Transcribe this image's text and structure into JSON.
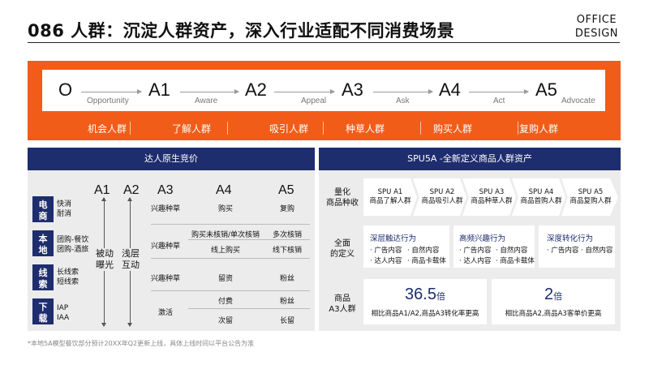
{
  "header": {
    "title": "086 人群：沉淀人群资产，深入行业适配不同消费场景",
    "brand_line1": "OFFICE",
    "brand_line2": "DESIGN"
  },
  "funnel": {
    "stages": [
      {
        "code": "O",
        "name": "Opportunity"
      },
      {
        "code": "A1",
        "name": "Aware"
      },
      {
        "code": "A2",
        "name": "Appeal"
      },
      {
        "code": "A3",
        "name": "Ask"
      },
      {
        "code": "A4",
        "name": "Act"
      },
      {
        "code": "A5",
        "name": "Advocate"
      }
    ],
    "groups": [
      "机会人群",
      "了解人群",
      "吸引人群",
      "种草人群",
      "购买人群",
      "复购人群"
    ]
  },
  "left_panel": {
    "title": "达人原生竞价",
    "columns": [
      "A1",
      "A2",
      "A3",
      "A4",
      "A5"
    ],
    "a1_label": "被动\n曝光",
    "a2_label": "浅层\n互动",
    "categories": [
      {
        "label": "电商",
        "items": [
          "快消",
          "耐消"
        ]
      },
      {
        "label": "本地",
        "items": [
          "团购-餐饮",
          "团购-酒旅"
        ]
      },
      {
        "label": "线索",
        "items": [
          "长线索",
          "短线索"
        ]
      },
      {
        "label": "下载",
        "items": [
          "IAP",
          "IAA"
        ]
      }
    ],
    "rows": [
      {
        "a3": "兴趣种草",
        "a4": "购买",
        "a5": "复购"
      },
      {
        "a3": "兴趣种草",
        "a4": "购买未核销/单次核销",
        "a5": "多次核销"
      },
      {
        "a3": "",
        "a4": "线上购买",
        "a5": "线下核销"
      },
      {
        "a3": "兴趣种草",
        "a4": "留资",
        "a5": "粉丝"
      },
      {
        "a3": "激活",
        "a4": "付费",
        "a5": "粉丝"
      },
      {
        "a3": "",
        "a4": "次留",
        "a5": "长留"
      }
    ]
  },
  "right_panel": {
    "title": "SPU5A -全新定义商品人群资产",
    "row1_label": "量化\n商品种收",
    "spus": [
      {
        "code": "SPU A1",
        "name": "商品了解人群"
      },
      {
        "code": "SPU A2",
        "name": "商品吸引人群"
      },
      {
        "code": "SPU A3",
        "name": "商品种草人群"
      },
      {
        "code": "SPU A4",
        "name": "商品首购人群"
      },
      {
        "code": "SPU A5",
        "name": "商品复购人群"
      }
    ],
    "row2_label": "全面\n的定义",
    "behaviors": [
      {
        "title": "深层触达行为",
        "items": [
          "· 广告内容",
          "· 自然内容",
          "· 达人内容",
          "· 商品卡载体"
        ]
      },
      {
        "title": "高频兴趣行为",
        "items": [
          "· 广告内容",
          "· 自然内容",
          "· 达人内容",
          "· 商品卡载体"
        ]
      },
      {
        "title": "深度转化行为",
        "items": [
          "· 广告内容",
          "· 自然内容"
        ]
      }
    ],
    "row3_label": "商品\nA3人群",
    "stats": [
      {
        "value": "36.5",
        "unit": "倍",
        "desc": "相比商品A1/A2,商品A3转化率更高"
      },
      {
        "value": "2",
        "unit": "倍",
        "desc": "相比商品A2,商品A3客单价更高"
      }
    ]
  },
  "footnote": "*本地5A模型餐饮部分预计20XX年Q2更新上线，具体上线时间以平台公告为准",
  "colors": {
    "accent": "#F25C19",
    "navy": "#1E2D6E",
    "panel_bg": "#ECECEC"
  }
}
